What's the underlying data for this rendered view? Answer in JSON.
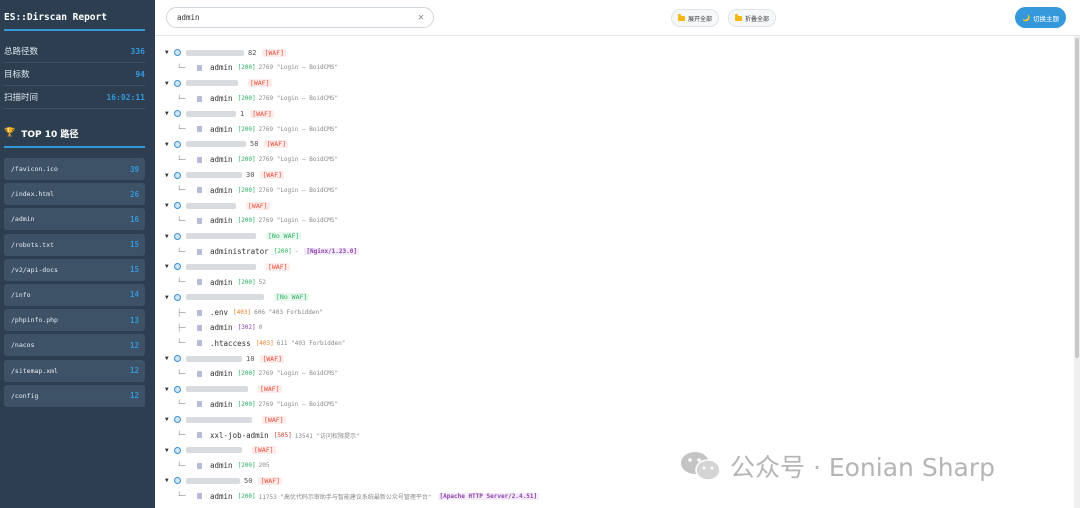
{
  "sidebar": {
    "title": "ES::Dirscan Report",
    "stats": [
      {
        "label": "总路径数",
        "value": "336"
      },
      {
        "label": "目标数",
        "value": "94"
      },
      {
        "label": "扫描时间",
        "value": "16:02:11"
      }
    ],
    "top_title": "TOP 10 路径",
    "top_items": [
      {
        "path": "/favicon.ico",
        "count": "39"
      },
      {
        "path": "/index.html",
        "count": "26"
      },
      {
        "path": "/admin",
        "count": "16"
      },
      {
        "path": "/robots.txt",
        "count": "15"
      },
      {
        "path": "/v2/api-docs",
        "count": "15"
      },
      {
        "path": "/info",
        "count": "14"
      },
      {
        "path": "/phpinfo.php",
        "count": "13"
      },
      {
        "path": "/nacos",
        "count": "12"
      },
      {
        "path": "/sitemap.xml",
        "count": "12"
      },
      {
        "path": "/config",
        "count": "12"
      }
    ]
  },
  "header": {
    "search_value": "admin",
    "clear_icon": "✕",
    "expand_all": "展开全部",
    "collapse_all": "折叠全部",
    "theme_toggle": "切换主题",
    "theme_icon": "🌙"
  },
  "tree": [
    {
      "suffix": "82",
      "waf": "[WAF]",
      "paths": [
        {
          "name": "admin",
          "status": "[200]",
          "meta": "2769 \"Login — BoidCMS\""
        }
      ]
    },
    {
      "suffix": "",
      "waf": "[WAF]",
      "paths": [
        {
          "name": "admin",
          "status": "[200]",
          "meta": "2769 \"Login — BoidCMS\""
        }
      ]
    },
    {
      "suffix": "1",
      "waf": "[WAF]",
      "paths": [
        {
          "name": "admin",
          "status": "[200]",
          "meta": "2769 \"Login — BoidCMS\""
        }
      ]
    },
    {
      "suffix": "58",
      "waf": "[WAF]",
      "paths": [
        {
          "name": "admin",
          "status": "[200]",
          "meta": "2769 \"Login — BoidCMS\""
        }
      ]
    },
    {
      "suffix": "30",
      "waf": "[WAF]",
      "paths": [
        {
          "name": "admin",
          "status": "[200]",
          "meta": "2769 \"Login — BoidCMS\""
        }
      ]
    },
    {
      "suffix": "",
      "waf": "[WAF]",
      "paths": [
        {
          "name": "admin",
          "status": "[200]",
          "meta": "2769 \"Login — BoidCMS\""
        }
      ]
    },
    {
      "suffix": "",
      "waf": "[No WAF]",
      "paths": [
        {
          "name": "administrator",
          "status": "[200]",
          "meta": "-",
          "server": "[Nginx/1.23.0]"
        }
      ]
    },
    {
      "suffix": "",
      "waf": "[WAF]",
      "paths": [
        {
          "name": "admin",
          "status": "[200]",
          "meta": "52"
        }
      ]
    },
    {
      "suffix": "",
      "waf": "[No WAF]",
      "paths": [
        {
          "name": ".env",
          "status": "[403]",
          "meta": "606 \"403 Forbidden\""
        },
        {
          "name": "admin",
          "status": "[302]",
          "meta": "0"
        },
        {
          "name": ".htaccess",
          "status": "[403]",
          "meta": "611 \"403 Forbidden\""
        }
      ]
    },
    {
      "suffix": "10",
      "waf": "[WAF]",
      "paths": [
        {
          "name": "admin",
          "status": "[200]",
          "meta": "2769 \"Login — BoidCMS\""
        }
      ]
    },
    {
      "suffix": "",
      "waf": "[WAF]",
      "paths": [
        {
          "name": "admin",
          "status": "[200]",
          "meta": "2769 \"Login — BoidCMS\""
        }
      ]
    },
    {
      "suffix": "",
      "waf": "[WAF]",
      "paths": [
        {
          "name": "xxl-job-admin",
          "status": "[505]",
          "meta": "13541 \"访问权限提示\""
        }
      ]
    },
    {
      "suffix": "",
      "waf": "[WAF]",
      "paths": [
        {
          "name": "admin",
          "status": "[200]",
          "meta": "205"
        }
      ]
    },
    {
      "suffix": "50",
      "waf": "[WAF]",
      "paths": [
        {
          "name": "admin",
          "status": "[200]",
          "meta": "11753 \"高优代码示审助手与智能建议系统最新公众号管理平台\"",
          "server": "[Apache HTTP Server/2.4.51]"
        }
      ]
    }
  ],
  "watermark": "公众号 · Eonian Sharp",
  "colors": {
    "sidebar_bg": "#2c3e50",
    "accent": "#3498db",
    "waf": "#e74c3c",
    "nowaf": "#27ae60"
  }
}
